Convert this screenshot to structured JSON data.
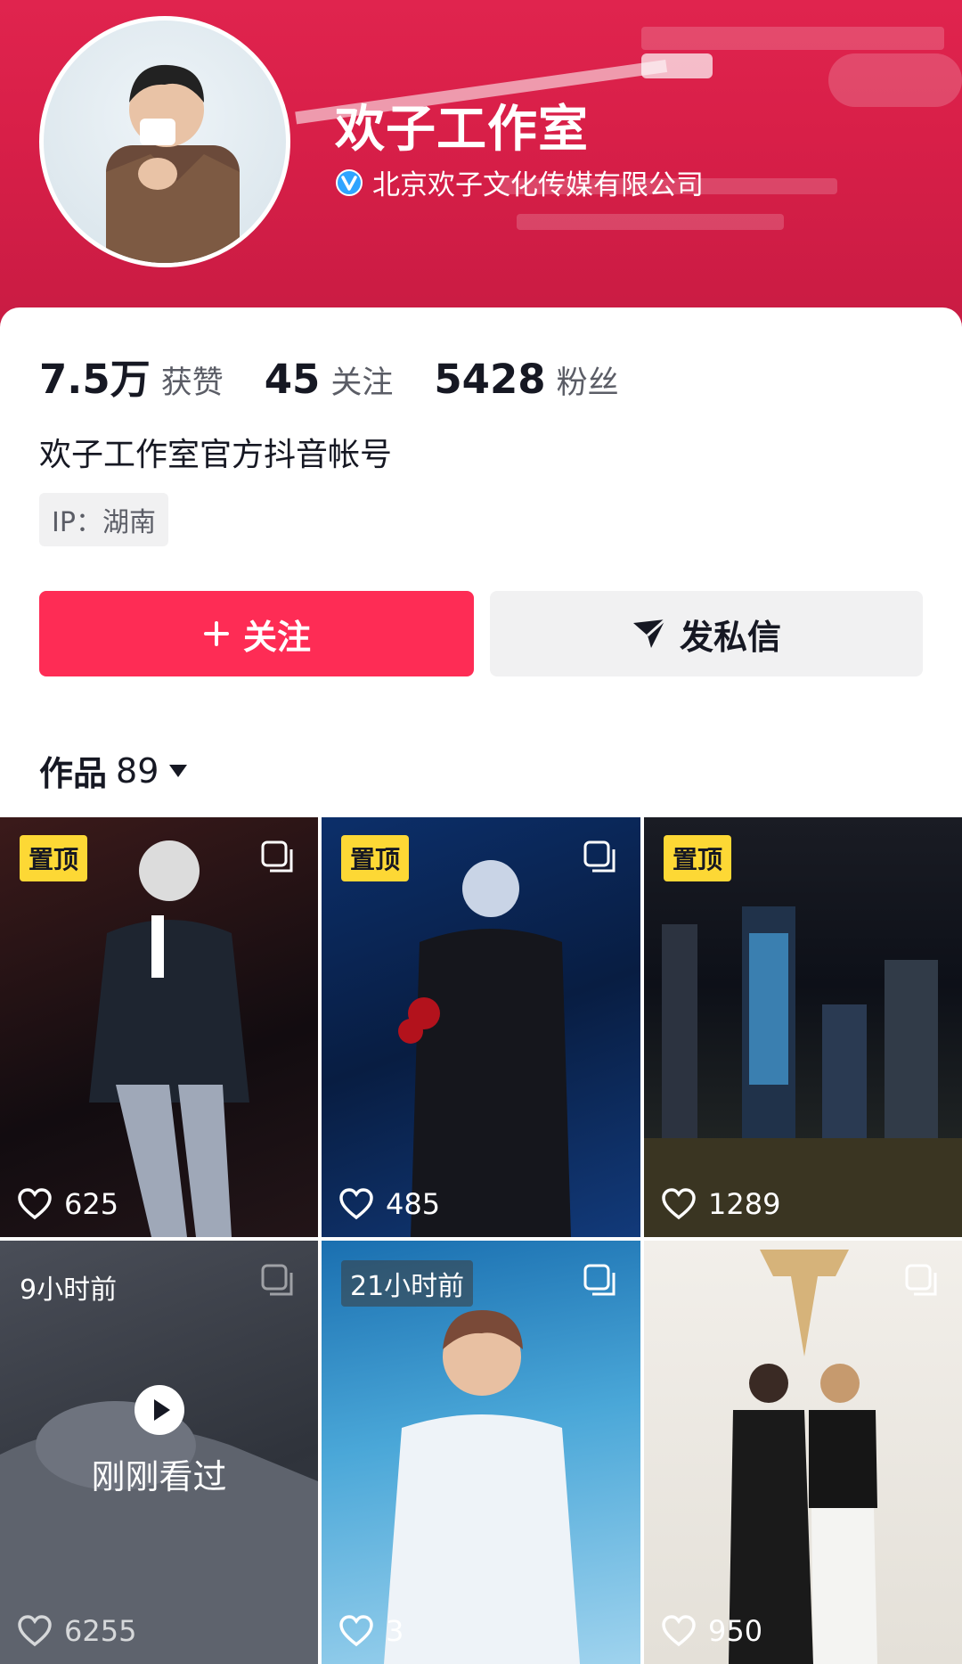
{
  "profile": {
    "name": "欢子工作室",
    "verified_org": "北京欢子文化传媒有限公司",
    "bio": "欢子工作室官方抖音帐号",
    "ip_location": "IP：湖南"
  },
  "stats": [
    {
      "value": "7.5万",
      "label": "获赞"
    },
    {
      "value": "45",
      "label": "关注"
    },
    {
      "value": "5428",
      "label": "粉丝"
    }
  ],
  "actions": {
    "follow_label": "关注",
    "message_label": "发私信"
  },
  "works": {
    "label": "作品",
    "count": "89"
  },
  "videos": [
    {
      "badge": "置顶",
      "likes": "625",
      "icon": "heart-icon"
    },
    {
      "badge": "置顶",
      "likes": "485",
      "icon": "heart-icon"
    },
    {
      "badge": "置顶",
      "likes": "1289",
      "icon": "heart-icon"
    },
    {
      "time": "9小时前",
      "likes": "6255",
      "overlay": "刚刚看过",
      "icon": "heart-icon"
    },
    {
      "time": "21小时前",
      "likes": "3",
      "icon": "heart-icon"
    },
    {
      "likes": "950",
      "icon": "heart-icon"
    }
  ],
  "colors": {
    "brand_red": "#fe2c55",
    "header_red": "#d81f48",
    "pin_badge": "#fdd835"
  }
}
